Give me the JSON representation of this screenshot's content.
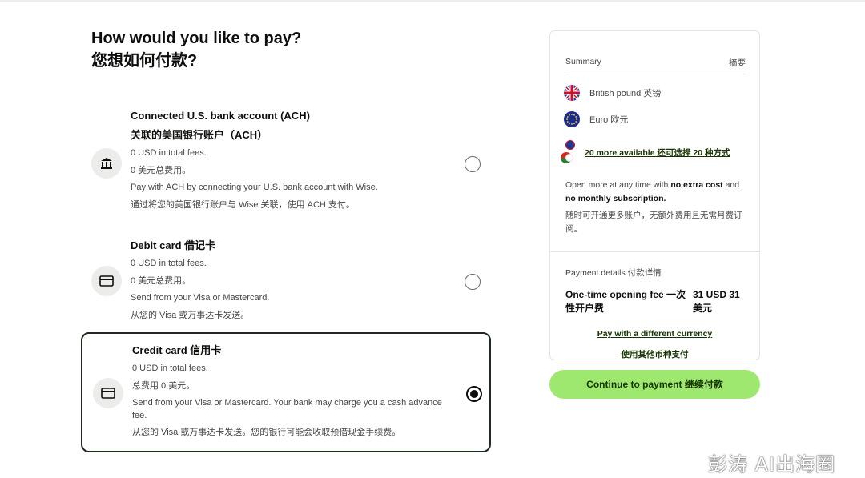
{
  "page": {
    "title_en": "How would you like to pay?",
    "title_zh": "您想如何付款?"
  },
  "options": [
    {
      "title": "Connected U.S. bank account (ACH)",
      "title_zh": "关联的美国银行账户（ACH）",
      "fees": "0 USD in total fees.",
      "fees_zh": "0 美元总费用。",
      "desc": "Pay with ACH by connecting your U.S. bank account with Wise.",
      "desc_zh": "通过将您的美国银行账户与 Wise 关联，使用 ACH 支付。",
      "icon": "bank-icon",
      "selected": false
    },
    {
      "title": "Debit card  借记卡",
      "fees": "0 USD in total fees.",
      "fees_zh": "0 美元总费用。",
      "desc": "Send from your Visa or Mastercard.",
      "desc_zh": "从您的 Visa 或万事达卡发送。",
      "icon": "card-icon",
      "selected": false
    },
    {
      "title": "Credit card  信用卡",
      "fees": "0 USD in total fees.",
      "fees_zh": "总费用 0 美元。",
      "desc": "Send from your Visa or Mastercard. Your bank may charge you a cash advance fee.",
      "desc_zh": "从您的 Visa 或万事达卡发送。您的银行可能会收取预借现金手续费。",
      "icon": "card-icon",
      "selected": true
    }
  ],
  "summary": {
    "heading": "Summary",
    "heading_zh": "摘要",
    "currencies": [
      {
        "label": "British pound  英镑",
        "icon": "uk-flag-icon"
      },
      {
        "label": "Euro  欧元",
        "icon": "eu-flag-icon"
      }
    ],
    "more_link": "20 more available  还可选择 20 种方式",
    "info_line1_pre": "Open more at any time with ",
    "info_line1_b1": "no extra cost",
    "info_line1_mid": " and ",
    "info_line1_b2": "no monthly subscription.",
    "info_zh": "随时可开通更多账户，无额外费用且无需月费订阅。"
  },
  "payment_details": {
    "heading": "Payment details  付款详情",
    "fee_label": "One-time opening fee 一次性开户费",
    "fee_value": "31 USD  31 美元",
    "diff_link": "Pay with a different currency",
    "diff_link_zh": "使用其他币种支付"
  },
  "continue_button": "Continue to payment  继续付款",
  "watermark": "彭涛 AI出海圈",
  "colors": {
    "accent": "#9fe870",
    "link": "#163300",
    "border_selected": "#1f2b1f"
  }
}
